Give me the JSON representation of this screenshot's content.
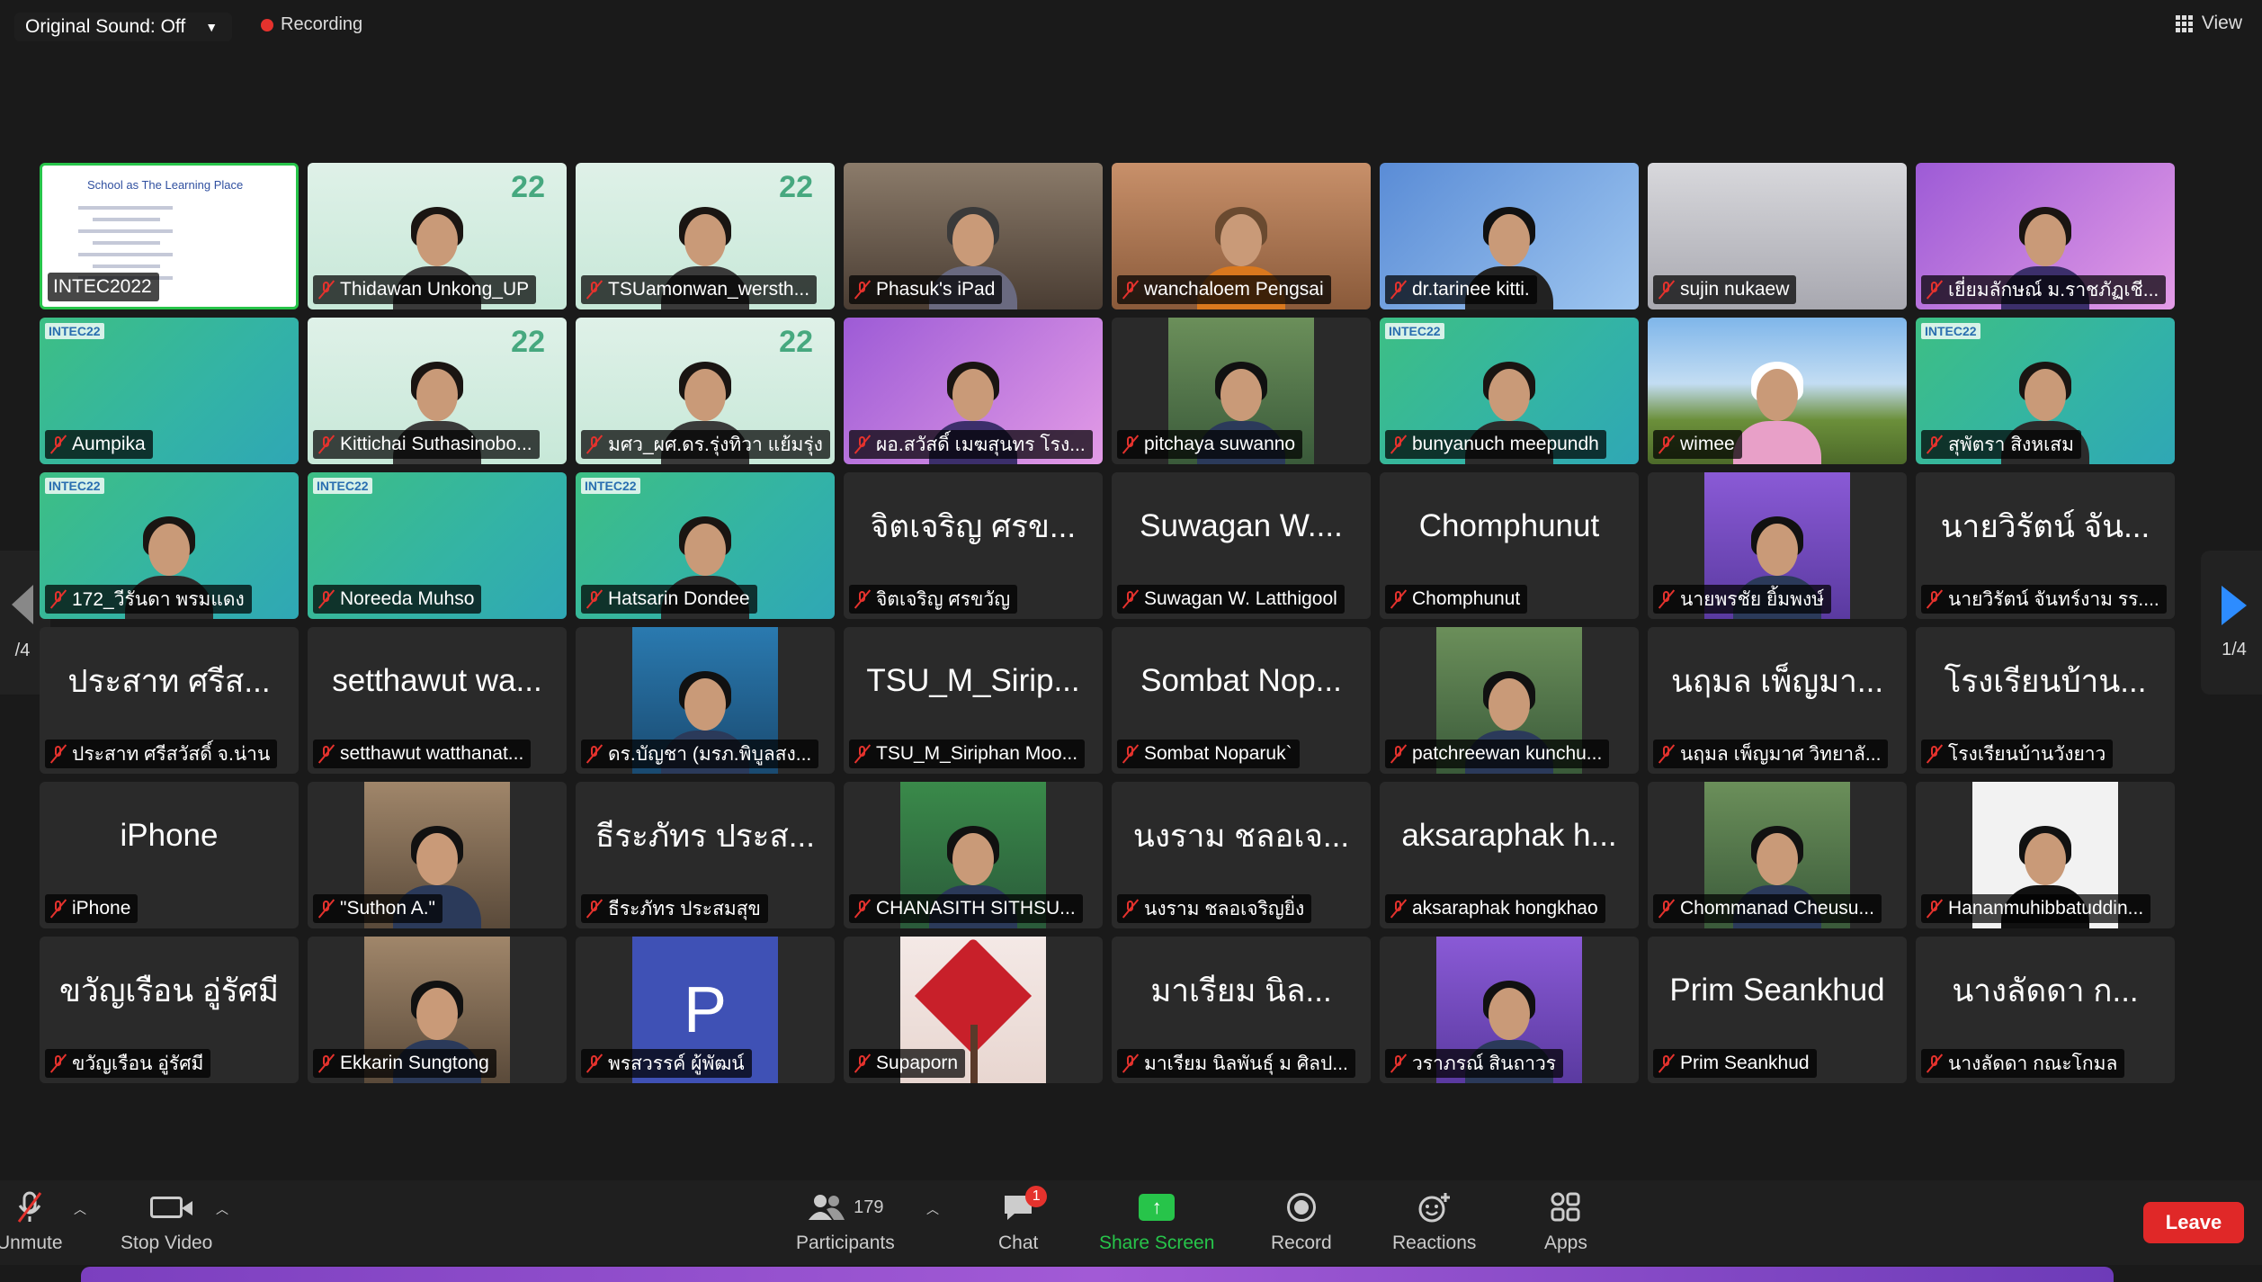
{
  "topbar": {
    "original_sound": "Original Sound: Off",
    "recording": "Recording",
    "view": "View"
  },
  "pager": {
    "left_text": "/4",
    "right_text": "1/4"
  },
  "tiles": [
    {
      "label": "INTEC2022",
      "kind": "slide",
      "active": true,
      "muted": false,
      "slide_title": "School as The Learning Place"
    },
    {
      "label": "Thidawan Unkong_UP",
      "kind": "video-mint"
    },
    {
      "label": "TSUamonwan_wersth...",
      "kind": "video-mint"
    },
    {
      "label": "Phasuk's iPad",
      "kind": "video-room"
    },
    {
      "label": "wanchaloem Pengsai",
      "kind": "video-orange"
    },
    {
      "label": "dr.tarinee kitti.",
      "kind": "video-blue"
    },
    {
      "label": "sujin  nukaew",
      "kind": "video-wall"
    },
    {
      "label": "เยี่ยมลักษณ์ ม.ราชภัฏเชี...",
      "kind": "video-purple"
    },
    {
      "label": "Aumpika",
      "kind": "video-green-empty"
    },
    {
      "label": "Kittichai Suthasinobo...",
      "kind": "video-mint"
    },
    {
      "label": "มศว_ผศ.ดร.รุ่งทิวา แย้มรุ่ง",
      "kind": "video-mint"
    },
    {
      "label": "ผอ.สวัสดิ์ เมฆสุนทร โรง...",
      "kind": "video-purple"
    },
    {
      "label": "pitchaya suwanno",
      "kind": "photo"
    },
    {
      "label": "bunyanuch meepundh",
      "kind": "video-green"
    },
    {
      "label": "wimee",
      "kind": "video-sky"
    },
    {
      "label": "สุพัตรา สิงหเสม",
      "kind": "video-green"
    },
    {
      "label": "172_วีรันดา พรมแดง",
      "kind": "video-green"
    },
    {
      "label": "Noreeda Muhso",
      "kind": "video-green-empty"
    },
    {
      "label": "Hatsarin Dondee",
      "kind": "video-green"
    },
    {
      "label": "จิตเจริญ  ศรขวัญ",
      "kind": "name",
      "big": "จิตเจริญ  ศรข..."
    },
    {
      "label": "Suwagan W. Latthigool",
      "kind": "name",
      "big": "Suwagan W...."
    },
    {
      "label": "Chomphunut",
      "kind": "name",
      "big": "Chomphunut"
    },
    {
      "label": "นายพรชัย ยิ้มพงษ์",
      "kind": "photo-purple"
    },
    {
      "label": "นายวิรัตน์  จันทร์งาม รร....",
      "kind": "name",
      "big": "นายวิรัตน์  จัน..."
    },
    {
      "label": "ประสาท ศรีสวัสดิ์ จ.น่าน",
      "kind": "name",
      "big": "ประสาท ศรีส..."
    },
    {
      "label": "setthawut watthanat...",
      "kind": "name",
      "big": "setthawut wa..."
    },
    {
      "label": "ดร.บัญชา (มรภ.พิบูลสง...",
      "kind": "photo-blue"
    },
    {
      "label": "TSU_M_Siriphan Moo...",
      "kind": "name",
      "big": "TSU_M_Sirip..."
    },
    {
      "label": "Sombat Noparuk`",
      "kind": "name",
      "big": "Sombat Nop..."
    },
    {
      "label": "patchreewan kunchu...",
      "kind": "photo"
    },
    {
      "label": "นฤมล เพ็ญมาศ วิทยาลั...",
      "kind": "name",
      "big": "นฤมล เพ็ญมา..."
    },
    {
      "label": "โรงเรียนบ้านวังยาว",
      "kind": "name",
      "big": "โรงเรียนบ้าน..."
    },
    {
      "label": "iPhone",
      "kind": "name",
      "big": "iPhone"
    },
    {
      "label": "\"Suthon A.\"",
      "kind": "photo-room"
    },
    {
      "label": "ธีระภัทร ประสมสุข",
      "kind": "name",
      "big": "ธีระภัทร ประส..."
    },
    {
      "label": "CHANASITH SITHSU...",
      "kind": "photo-green"
    },
    {
      "label": "นงราม ชลอเจริญยิ่ง",
      "kind": "name",
      "big": "นงราม ชลอเจ..."
    },
    {
      "label": "aksaraphak hongkhao",
      "kind": "name",
      "big": "aksaraphak h..."
    },
    {
      "label": "Chommanad Cheusu...",
      "kind": "photo"
    },
    {
      "label": "Hananmuhibbatuddin...",
      "kind": "photo-white"
    },
    {
      "label": "ขวัญเรือน อู่รัศมี",
      "kind": "name",
      "big": "ขวัญเรือน อู่รัศมี"
    },
    {
      "label": "Ekkarin Sungtong",
      "kind": "photo-room"
    },
    {
      "label": "พรสวรรค์ ผู้พัฒน์",
      "kind": "avatar",
      "initial": "P"
    },
    {
      "label": "Supaporn",
      "kind": "heart"
    },
    {
      "label": "มาเรียม นิลพันธุ์ ม ศิลป...",
      "kind": "name",
      "big": "มาเรียม นิล..."
    },
    {
      "label": "วราภรณ์ สินถาวร",
      "kind": "photo-purple"
    },
    {
      "label": "Prim Seankhud",
      "kind": "name",
      "big": "Prim Seankhud"
    },
    {
      "label": "นางลัดดา กณะโกมล",
      "kind": "name",
      "big": "นางลัดดา  ก..."
    }
  ],
  "toolbar": {
    "unmute": "Unmute",
    "stop_video": "Stop Video",
    "participants": "Participants",
    "participants_count": "179",
    "chat": "Chat",
    "chat_badge": "1",
    "share_screen": "Share Screen",
    "record": "Record",
    "reactions": "Reactions",
    "apps": "Apps",
    "leave": "Leave"
  },
  "colors": {
    "active_border": "#27c44a",
    "leave": "#e02828",
    "share": "#27c44a",
    "muted_icon": "#e5322d"
  }
}
